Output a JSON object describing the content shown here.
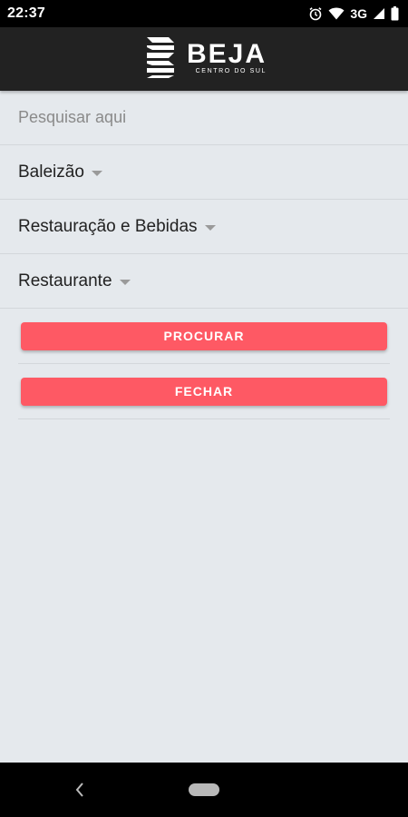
{
  "status_bar": {
    "time": "22:37",
    "network": "3G"
  },
  "header": {
    "title": "BEJA",
    "subtitle": "CENTRO DO SUL"
  },
  "search": {
    "placeholder": "Pesquisar aqui",
    "value": ""
  },
  "filters": [
    {
      "label": "Baleizão"
    },
    {
      "label": "Restauração e Bebidas"
    },
    {
      "label": "Restaurante"
    }
  ],
  "buttons": {
    "search_label": "PROCURAR",
    "close_label": "FECHAR"
  },
  "colors": {
    "accent": "#fe5964",
    "header_bg": "#222222",
    "page_bg": "#e5e9ed"
  }
}
